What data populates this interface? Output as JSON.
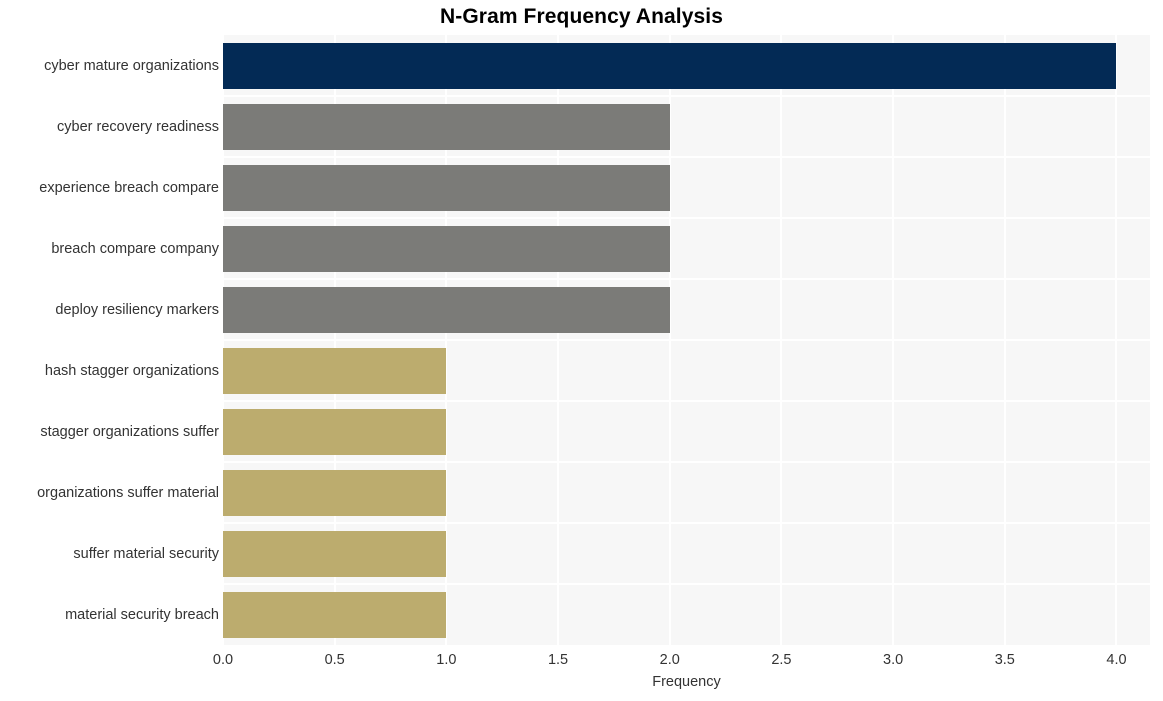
{
  "chart_data": {
    "type": "bar",
    "orientation": "horizontal",
    "title": "N-Gram Frequency Analysis",
    "xlabel": "Frequency",
    "ylabel": "",
    "xlim": [
      0,
      4.15
    ],
    "xticks": [
      "0.0",
      "0.5",
      "1.0",
      "1.5",
      "2.0",
      "2.5",
      "3.0",
      "3.5",
      "4.0"
    ],
    "xtick_values": [
      0.0,
      0.5,
      1.0,
      1.5,
      2.0,
      2.5,
      3.0,
      3.5,
      4.0
    ],
    "grid": true,
    "legend": "none",
    "categories": [
      "cyber mature organizations",
      "cyber recovery readiness",
      "experience breach compare",
      "breach compare company",
      "deploy resiliency markers",
      "hash stagger organizations",
      "stagger organizations suffer",
      "organizations suffer material",
      "suffer material security",
      "material security breach"
    ],
    "values": [
      4,
      2,
      2,
      2,
      2,
      1,
      1,
      1,
      1,
      1
    ],
    "bar_colors": [
      "#032a55",
      "#7b7b78",
      "#7b7b78",
      "#7b7b78",
      "#7b7b78",
      "#bcac6e",
      "#bcac6e",
      "#bcac6e",
      "#bcac6e",
      "#bcac6e"
    ]
  },
  "style": {
    "plot_background": "#f7f7f7",
    "figure_background": "#ffffff",
    "grid_color": "#ffffff",
    "tick_label_color": "#333333",
    "title_color": "#000000"
  }
}
